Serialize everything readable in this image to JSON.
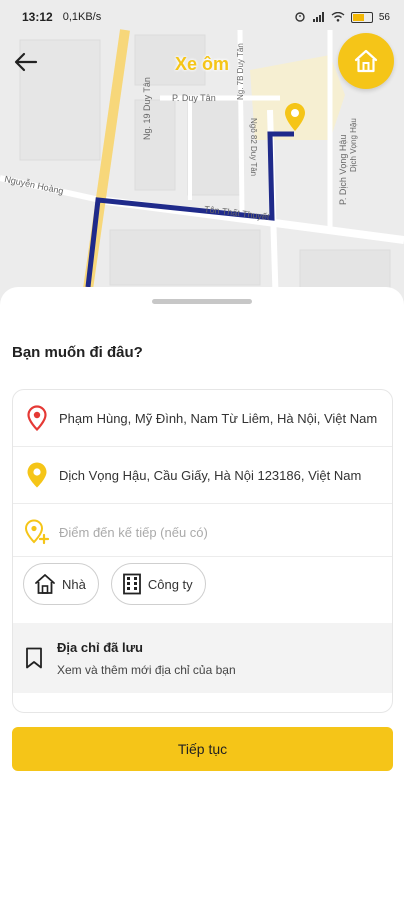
{
  "status_bar": {
    "time": "13:12",
    "network_speed": "0,1KB/s",
    "battery": "56"
  },
  "map": {
    "title": "Xe ôm",
    "streets": [
      "P. Duy Tân",
      "Ng. 19 Duy Tân",
      "Nguyễn Hoàng",
      "Tôn Thất Thuyết",
      "P. Dịch Vọng Hậu",
      "Ng. 7B Duy Tân",
      "Ngõ 82 Duy Tân",
      "Dịch Vọng Hậu"
    ]
  },
  "sheet": {
    "title": "Bạn muốn đi đâu?",
    "pickup": "Phạm Hùng, Mỹ Đình, Nam Từ Liêm, Hà Nội, Việt Nam",
    "destination": "Dịch Vọng Hậu, Cầu Giấy, Hà Nội 123186, Việt Nam",
    "next_stop_placeholder": "Điểm đến kế tiếp (nếu có)",
    "chips": {
      "home": "Nhà",
      "work": "Công ty"
    },
    "saved": {
      "title": "Địa chỉ đã lưu",
      "subtitle": "Xem và thêm mới địa chỉ của bạn"
    },
    "continue_label": "Tiếp tục"
  },
  "colors": {
    "accent": "#f5c518",
    "route": "#1f2a8a",
    "pickup_pin": "#e53935"
  }
}
